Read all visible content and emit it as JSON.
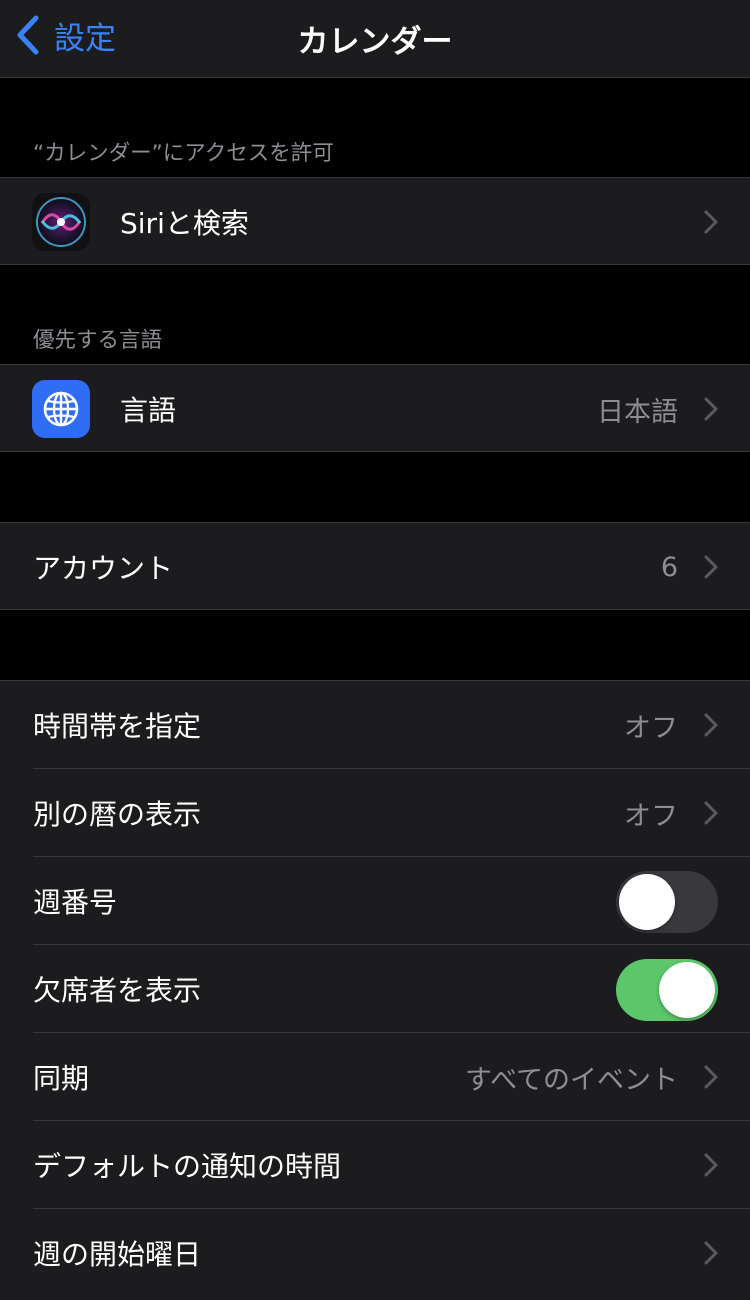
{
  "nav": {
    "back_label": "設定",
    "title": "カレンダー"
  },
  "sections": {
    "access_header": "“カレンダー”にアクセスを許可",
    "siri_label": "Siriと検索",
    "language_header": "優先する言語",
    "language_label": "言語",
    "language_value": "日本語",
    "accounts_label": "アカウント",
    "accounts_value": "6"
  },
  "settings": {
    "timezone_label": "時間帯を指定",
    "timezone_value": "オフ",
    "alt_calendar_label": "別の暦の表示",
    "alt_calendar_value": "オフ",
    "week_numbers_label": "週番号",
    "week_numbers_on": false,
    "show_declined_label": "欠席者を表示",
    "show_declined_on": true,
    "sync_label": "同期",
    "sync_value": "すべてのイベント",
    "default_alert_label": "デフォルトの通知の時間",
    "start_week_label": "週の開始曜日"
  },
  "colors": {
    "accent": "#3a82f7",
    "toggle_on": "#5cc76a",
    "toggle_off": "#39393d",
    "cell": "#1c1c1e",
    "background": "#000000",
    "secondary_text": "#8d8d93"
  },
  "icons": [
    "chevron-left-icon",
    "siri-icon",
    "globe-icon",
    "chevron-right-icon"
  ]
}
